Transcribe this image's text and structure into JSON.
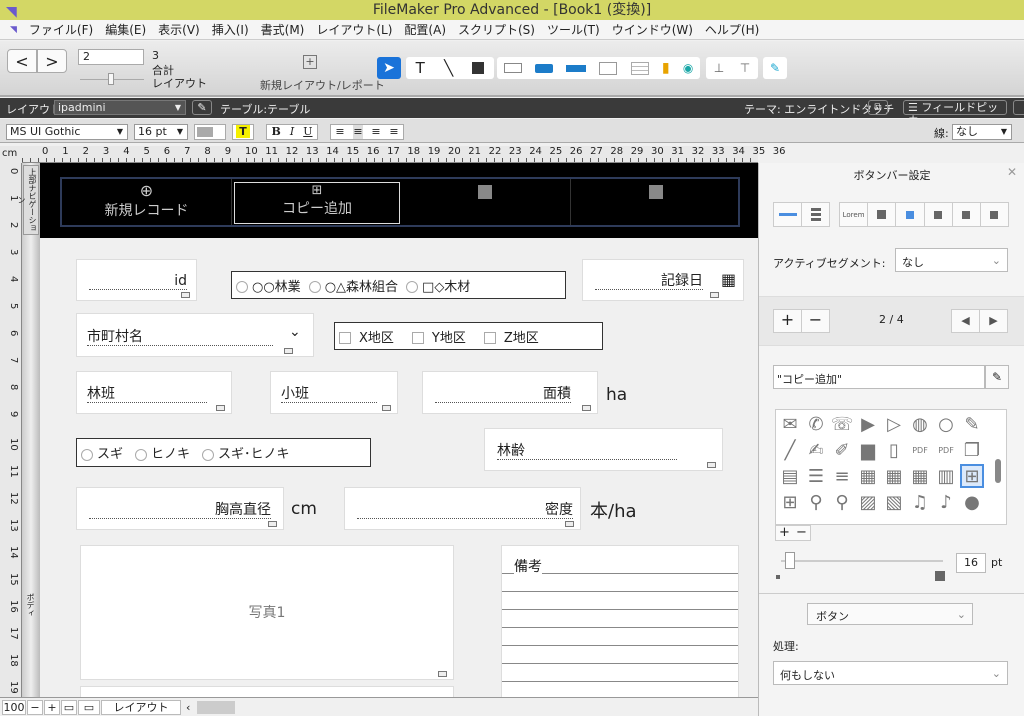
{
  "window": {
    "title": "FileMaker Pro Advanced - [Book1 (変換)]"
  },
  "menu": [
    "ファイル(F)",
    "編集(E)",
    "表示(V)",
    "挿入(I)",
    "書式(M)",
    "レイアウト(L)",
    "配置(A)",
    "スクリプト(S)",
    "ツール(T)",
    "ウインドウ(W)",
    "ヘルプ(H)"
  ],
  "toolbar": {
    "record_value": "2",
    "total": "3",
    "total_label": "合計",
    "mode_label": "レイアウト",
    "new_layout_label": "新規レイアウト/レポート"
  },
  "layoutbar": {
    "layout_label": "レイアウト:",
    "layout_value": "ipadmini",
    "table_label": "テーブル:テーブル",
    "theme_label": "テーマ: エンライトンドタッチ",
    "field_picker": "フィールドピッカー"
  },
  "formatbar": {
    "font": "MS UI Gothic",
    "size": "16 pt",
    "line_label": "線:",
    "line_value": "なし",
    "bold": "B",
    "italic": "I",
    "underline": "U",
    "highlight": "T"
  },
  "ruler": {
    "unit": "cm",
    "ticks": [
      "0",
      "1",
      "2",
      "3",
      "4",
      "5",
      "6",
      "7",
      "8",
      "9",
      "10",
      "11",
      "12",
      "13",
      "14",
      "15",
      "16",
      "17",
      "18",
      "19",
      "20",
      "21",
      "22",
      "23",
      "24",
      "25",
      "26",
      "27",
      "28",
      "29",
      "30",
      "31",
      "32",
      "33",
      "34",
      "35",
      "36"
    ],
    "vticks": [
      "0",
      "1",
      "2",
      "3",
      "4",
      "5",
      "6",
      "7",
      "8",
      "9",
      "10",
      "11",
      "12",
      "13",
      "14",
      "15",
      "16",
      "17",
      "18",
      "19"
    ]
  },
  "parts": {
    "header": "上部ナビゲーション",
    "body": "ボディ"
  },
  "header_buttons": [
    {
      "label": "新規レコード",
      "icon": "plus-circle"
    },
    {
      "label": "コピー追加",
      "icon": "copy-plus"
    },
    {
      "label": "",
      "icon": "square"
    },
    {
      "label": "",
      "icon": "square"
    }
  ],
  "fields": {
    "id": "id",
    "owner_options": [
      "○○林業",
      "○△森林組合",
      "□◇木材"
    ],
    "record_date": "記録日",
    "municipality": "市町村名",
    "district_options": [
      "X地区",
      "Y地区",
      "Z地区"
    ],
    "rinpan": "林班",
    "shohan": "小班",
    "area": "面積",
    "area_unit": "ha",
    "species_options": [
      "スギ",
      "ヒノキ",
      "スギ･ヒノキ"
    ],
    "age": "林齢",
    "dbh": "胸高直径",
    "dbh_unit": "cm",
    "density": "密度",
    "density_unit": "本/ha",
    "photo": "写真1",
    "notes": "備考"
  },
  "inspector": {
    "title": "ボタンバー設定",
    "active_segment_label": "アクティブセグメント:",
    "active_segment_value": "なし",
    "segment_counter": "2 / 4",
    "segment_label_value": "\"コピー追加\"",
    "lorem": "Lorem",
    "icon_size": "16",
    "icon_size_unit": "pt",
    "type_value": "ボタン",
    "action_label": "処理:",
    "action_value": "何もしない"
  },
  "statusbar": {
    "zoom": "100",
    "mode": "レイアウト"
  },
  "colors": {
    "titlebar": "#d3d765",
    "header_part": "#000000",
    "selection": "#1a73d9"
  }
}
